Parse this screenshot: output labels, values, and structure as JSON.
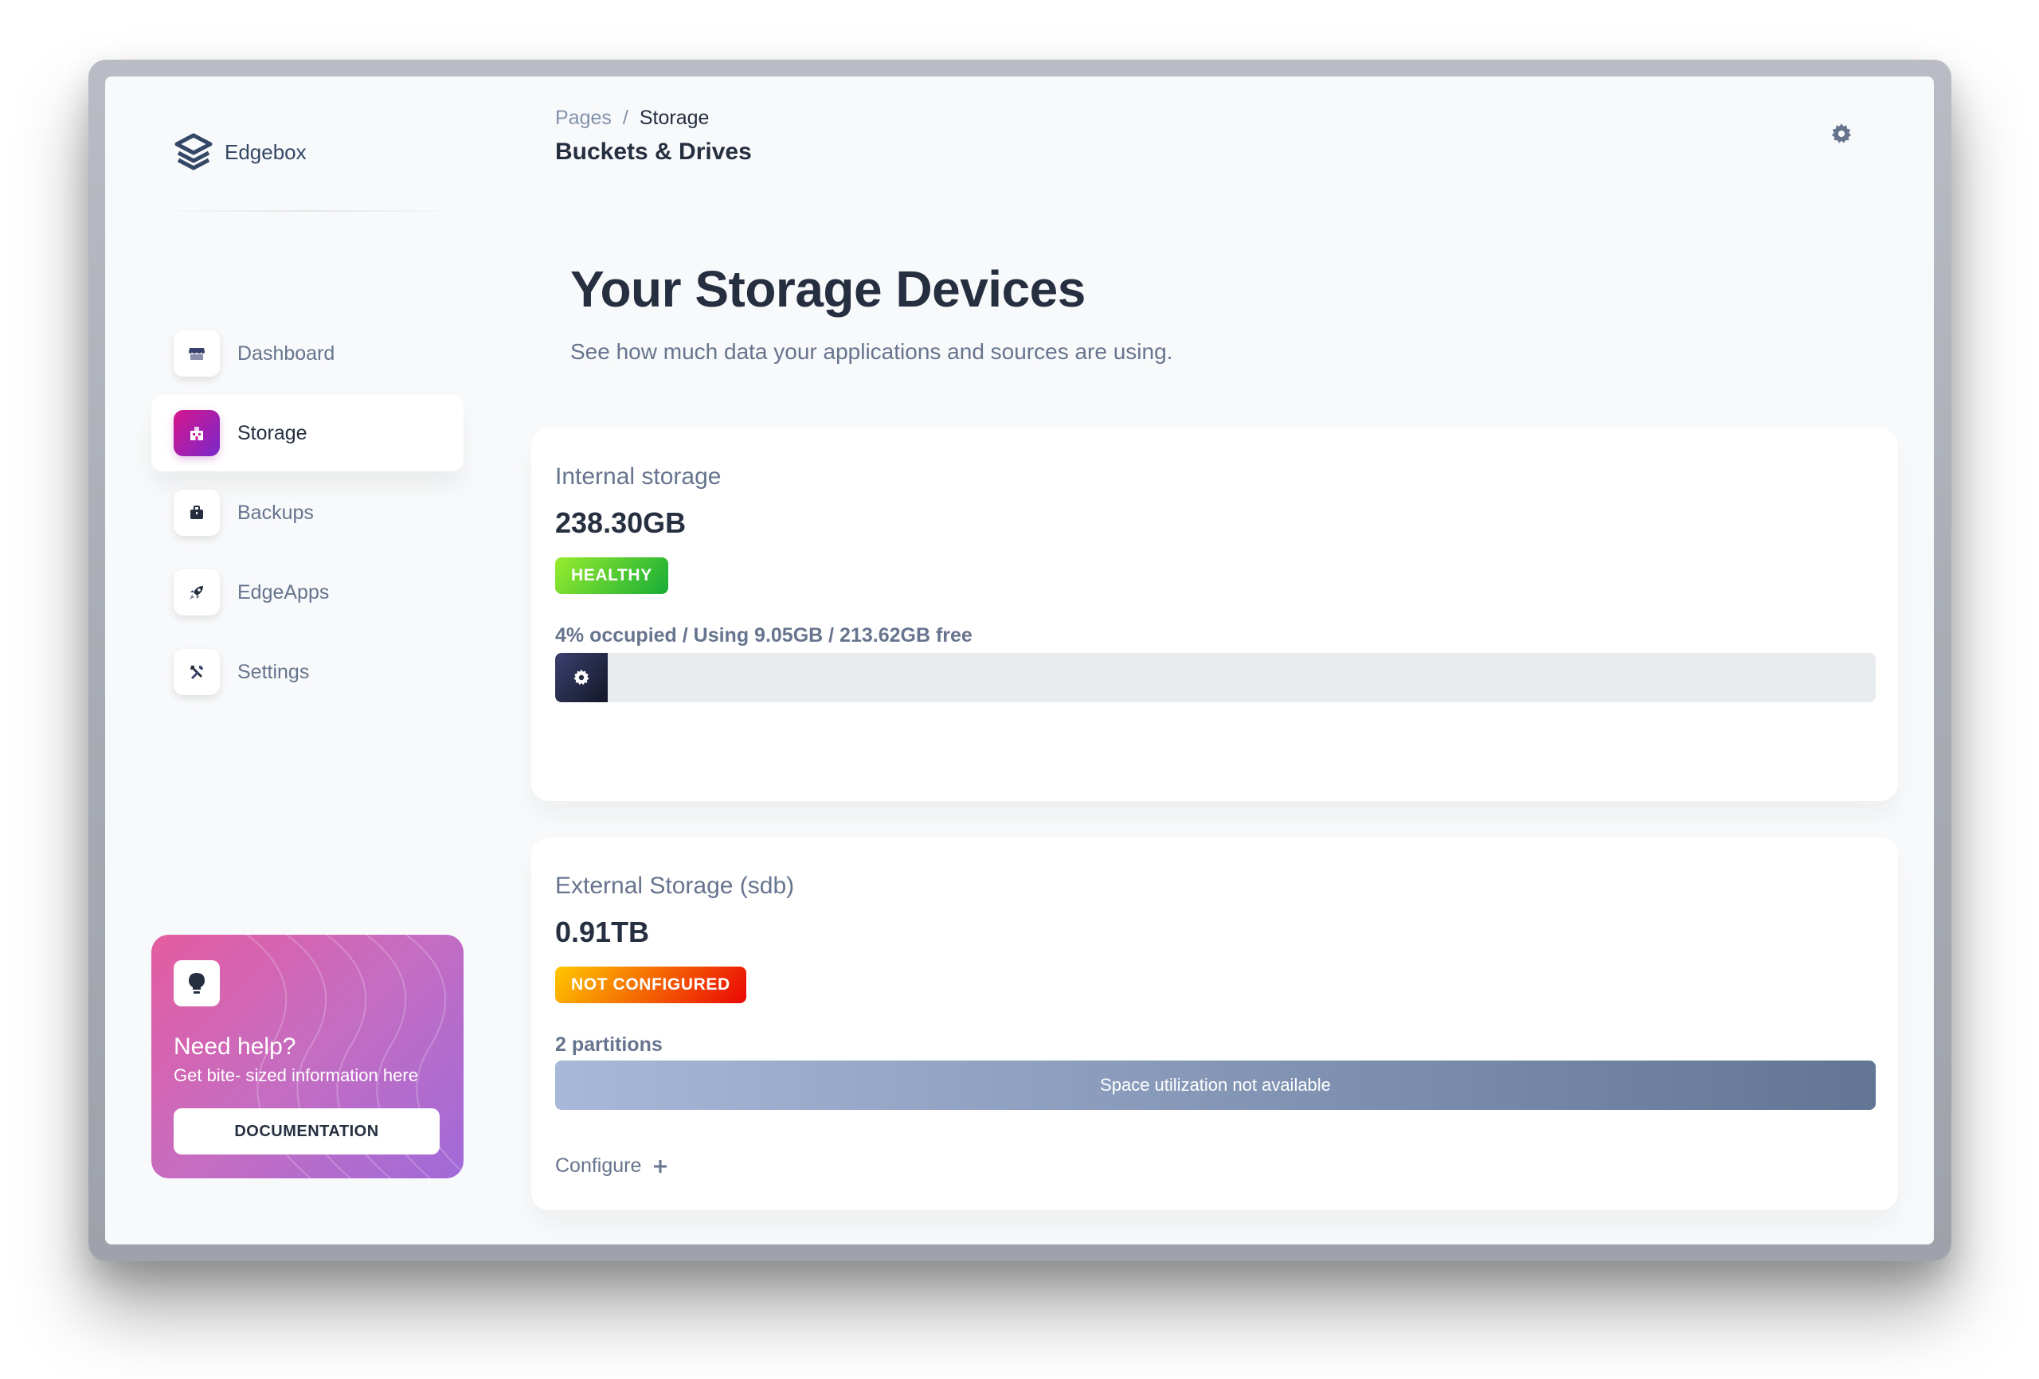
{
  "brand": {
    "name": "Edgebox"
  },
  "sidebar": {
    "items": [
      {
        "label": "Dashboard",
        "icon": "shop-icon"
      },
      {
        "label": "Storage",
        "icon": "office-building-icon",
        "active": true
      },
      {
        "label": "Backups",
        "icon": "briefcase-icon"
      },
      {
        "label": "EdgeApps",
        "icon": "rocket-icon"
      },
      {
        "label": "Settings",
        "icon": "wrench-tools-icon"
      }
    ]
  },
  "help": {
    "title": "Need help?",
    "subtitle": "Get bite- sized information here",
    "button": "DOCUMENTATION",
    "icon": "lightbulb-icon"
  },
  "header": {
    "breadcrumb_parent": "Pages",
    "breadcrumb_separator": "/",
    "breadcrumb_current": "Storage",
    "subtitle": "Buckets & Drives",
    "settings_icon": "gear-icon"
  },
  "main": {
    "title": "Your Storage Devices",
    "subtitle": "See how much data your applications and sources are using."
  },
  "storage": {
    "internal": {
      "title": "Internal storage",
      "size": "238.30GB",
      "status": "HEALTHY",
      "usage_text": "4% occupied / Using 9.05GB / 213.62GB free",
      "occupied_fraction": 0.04
    },
    "external": {
      "title": "External Storage (sdb)",
      "size": "0.91TB",
      "status": "NOT CONFIGURED",
      "partitions_text": "2 partitions",
      "utilization_text": "Space utilization not available",
      "configure_label": "Configure"
    }
  },
  "colors": {
    "healthy": "#17ad37",
    "not_configured": "#ea0606",
    "active_nav": "#d6168d",
    "progress": "#3a416f"
  }
}
